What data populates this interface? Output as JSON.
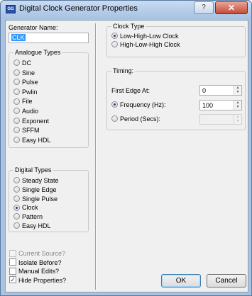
{
  "window": {
    "title": "Digital Clock Generator Properties",
    "app_icon_text": "GG",
    "help_label": "?",
    "close_label": "✕"
  },
  "generator": {
    "name_label": "Generator Name:",
    "name_value": "CLK"
  },
  "analogue": {
    "title": "Analogue Types",
    "options": [
      "DC",
      "Sine",
      "Pulse",
      "Pwlin",
      "File",
      "Audio",
      "Exponent",
      "SFFM",
      "Easy HDL"
    ]
  },
  "digital": {
    "title": "Digital Types",
    "options": [
      "Steady State",
      "Single Edge",
      "Single Pulse",
      "Clock",
      "Pattern",
      "Easy HDL"
    ],
    "selected": "Clock"
  },
  "checkboxes": [
    {
      "label": "Current Source?",
      "checked": false,
      "disabled": true
    },
    {
      "label": "Isolate Before?",
      "checked": false,
      "disabled": false
    },
    {
      "label": "Manual Edits?",
      "checked": false,
      "disabled": false
    },
    {
      "label": "Hide Properties?",
      "checked": true,
      "disabled": false
    }
  ],
  "clock_type": {
    "title": "Clock Type",
    "options": [
      "Low-High-Low Clock",
      "High-Low-High Clock"
    ],
    "selected": "Low-High-Low Clock"
  },
  "timing": {
    "title": "Timing:",
    "first_edge_label": "First Edge At:",
    "first_edge_value": "0",
    "frequency_label": "Frequency (Hz):",
    "frequency_value": "100",
    "period_label": "Period (Secs):",
    "period_value": "",
    "selected": "Frequency (Hz):"
  },
  "buttons": {
    "ok": "OK",
    "cancel": "Cancel"
  }
}
